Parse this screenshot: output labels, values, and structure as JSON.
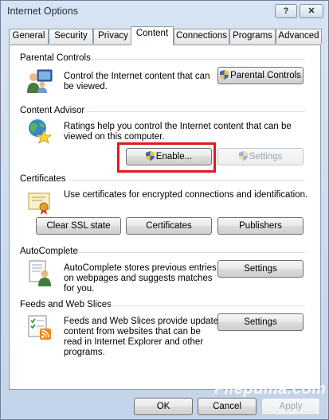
{
  "window": {
    "title": "Internet Options",
    "help": "?",
    "close": "✕"
  },
  "tabs": [
    "General",
    "Security",
    "Privacy",
    "Content",
    "Connections",
    "Programs",
    "Advanced"
  ],
  "parental": {
    "title": "Parental Controls",
    "desc1": "Control the Internet content that can",
    "desc2": "be viewed.",
    "button": "Parental Controls"
  },
  "advisor": {
    "title": "Content Advisor",
    "desc1": "Ratings help you control the Internet content that can be",
    "desc2": "viewed on this computer.",
    "enable": "Enable...",
    "settings": "Settings"
  },
  "certificates": {
    "title": "Certificates",
    "desc": "Use certificates for encrypted connections and identification.",
    "clear": "Clear SSL state",
    "certs": "Certificates",
    "publishers": "Publishers"
  },
  "autocomplete": {
    "title": "AutoComplete",
    "desc1": "AutoComplete stores previous entries",
    "desc2": "on webpages and suggests matches",
    "desc3": "for you.",
    "settings": "Settings"
  },
  "feeds": {
    "title": "Feeds and Web Slices",
    "desc1": "Feeds and Web Slices provide updated",
    "desc2": "content from websites that can be",
    "desc3": "read in Internet Explorer and other",
    "desc4": "programs.",
    "settings": "Settings"
  },
  "footer": {
    "ok": "OK",
    "cancel": "Cancel",
    "apply": "Apply"
  },
  "watermark": "Filepuma.com"
}
